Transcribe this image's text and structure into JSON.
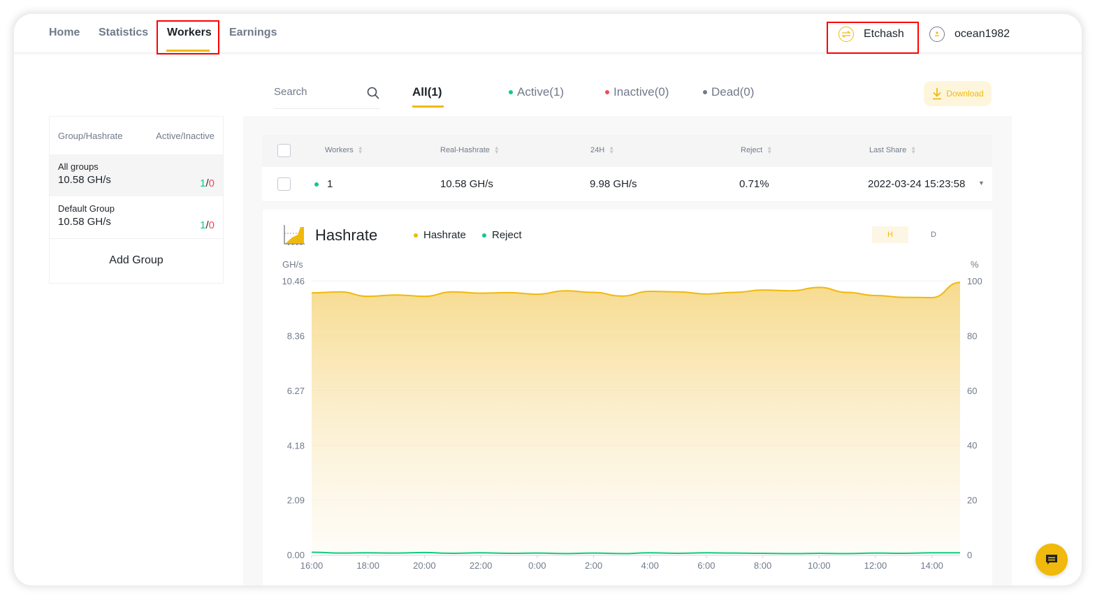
{
  "nav": {
    "items": [
      {
        "label": "Home",
        "active": false
      },
      {
        "label": "Statistics",
        "active": false
      },
      {
        "label": "Workers",
        "active": true
      },
      {
        "label": "Earnings",
        "active": false
      }
    ],
    "algorithm": "Etchash",
    "username": "ocean1982"
  },
  "filters": {
    "search_placeholder": "Search",
    "tabs": [
      {
        "label": "All(1)",
        "active": true
      },
      {
        "label": "Active(1)",
        "dot": "#0ecb81"
      },
      {
        "label": "Inactive(0)",
        "dot": "#f6465d"
      },
      {
        "label": "Dead(0)",
        "dot": "#707a8a"
      }
    ],
    "download_label": "Download"
  },
  "groups": {
    "header_left": "Group/Hashrate",
    "header_right": "Active/Inactive",
    "rows": [
      {
        "name": "All groups",
        "hashrate": "10.58 GH/s",
        "active": "1",
        "inactive": "0"
      },
      {
        "name": "Default Group",
        "hashrate": "10.58 GH/s",
        "active": "1",
        "inactive": "0"
      }
    ],
    "add_label": "Add Group"
  },
  "table": {
    "columns": [
      "Workers",
      "Real-Hashrate",
      "24H",
      "Reject",
      "Last Share"
    ],
    "rows": [
      {
        "worker": "1",
        "status_color": "#0ecb81",
        "real_hashrate": "10.58 GH/s",
        "h24": "9.98 GH/s",
        "reject": "0.71%",
        "last_share": "2022-03-24 15:23:58"
      }
    ]
  },
  "chart": {
    "title": "Hashrate",
    "legend": [
      {
        "label": "Hashrate",
        "color": "#f0b90b"
      },
      {
        "label": "Reject",
        "color": "#0ecb81"
      }
    ],
    "range_buttons": [
      {
        "label": "H",
        "active": true
      },
      {
        "label": "D",
        "active": false
      }
    ]
  },
  "chart_data": {
    "type": "area",
    "title": "Hashrate",
    "ylabel_left": "GH/s",
    "ylabel_right": "%",
    "yticks_left": [
      "0.00",
      "2.09",
      "4.18",
      "6.27",
      "8.36",
      "10.46"
    ],
    "yticks_right": [
      "0",
      "20",
      "40",
      "60",
      "80",
      "100"
    ],
    "ylim_left": [
      0,
      10.46
    ],
    "ylim_right": [
      0,
      100
    ],
    "xticks": [
      "16:00",
      "18:00",
      "20:00",
      "22:00",
      "0:00",
      "2:00",
      "4:00",
      "6:00",
      "8:00",
      "10:00",
      "12:00",
      "14:00"
    ],
    "x_hours": [
      0,
      1,
      2,
      3,
      4,
      5,
      6,
      7,
      8,
      9,
      10,
      11,
      12,
      13,
      14,
      15,
      16,
      17,
      18,
      19,
      20,
      21,
      22,
      23
    ],
    "series": [
      {
        "name": "Hashrate",
        "axis": "left",
        "color": "#f0b90b",
        "values": [
          10.0,
          10.04,
          9.87,
          9.92,
          9.87,
          10.04,
          9.99,
          10.01,
          9.95,
          10.08,
          10.02,
          9.88,
          10.06,
          10.04,
          9.96,
          10.02,
          10.11,
          10.08,
          10.21,
          10.02,
          9.9,
          9.83,
          9.82,
          10.4
        ]
      },
      {
        "name": "Reject",
        "axis": "right",
        "color": "#0ecb81",
        "values": [
          0.9,
          0.6,
          0.7,
          0.6,
          0.8,
          0.5,
          0.7,
          0.5,
          0.6,
          0.4,
          0.6,
          0.4,
          0.7,
          0.5,
          0.7,
          0.6,
          0.5,
          0.4,
          0.5,
          0.4,
          0.6,
          0.5,
          0.7,
          0.7
        ]
      }
    ],
    "grid": true,
    "legend_position": "top-left"
  }
}
